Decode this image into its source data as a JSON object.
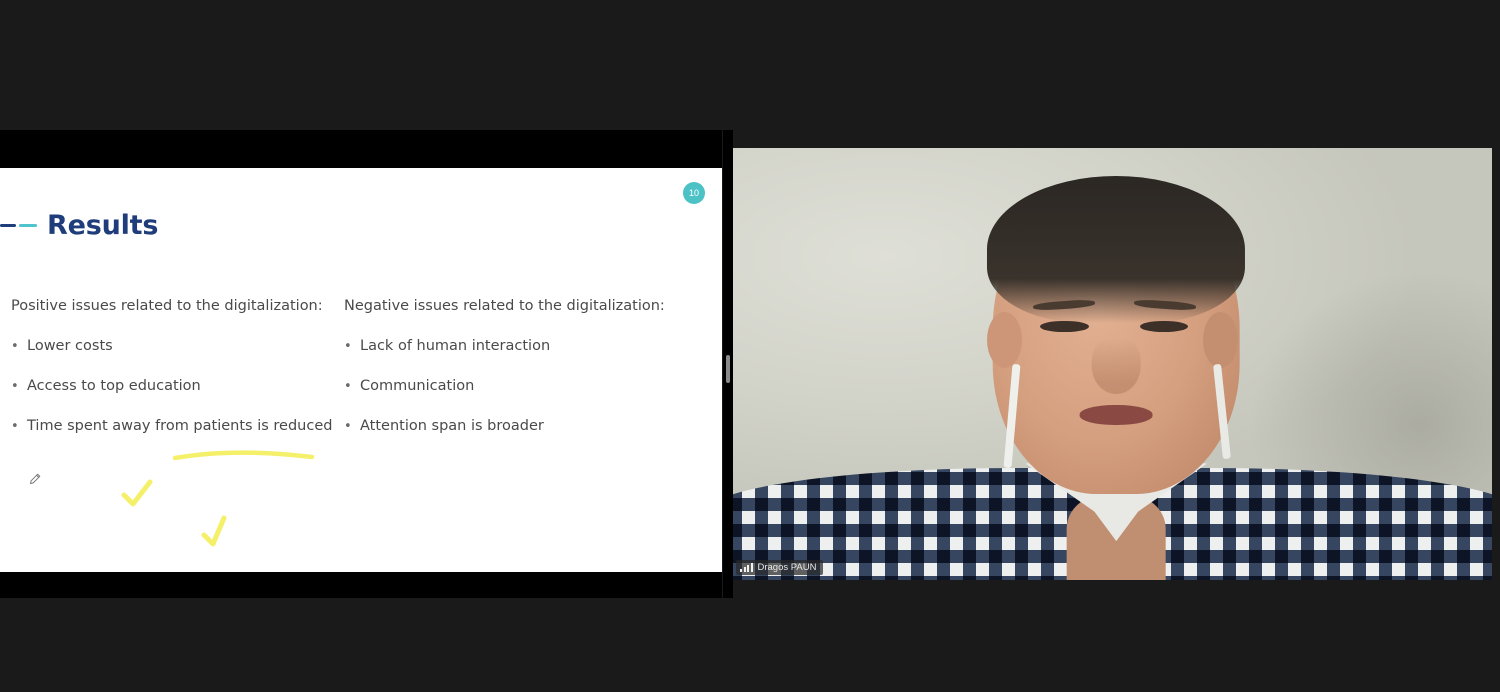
{
  "meeting": {
    "background_color": "#1a1a1a"
  },
  "shared_screen": {
    "panel_name": "shared-screen-panel",
    "slide": {
      "number_badge": "10",
      "title": "Results",
      "title_color": "#1f3d7a",
      "accent_colors": [
        "#1f3d7a",
        "#4fc3ce"
      ],
      "badge_color": "#4cc2c6",
      "columns": [
        {
          "heading": "Positive issues related to the digitalization:",
          "bullets": [
            "Lower costs",
            "Access to top education",
            "Time spent away from patients is reduced"
          ]
        },
        {
          "heading": "Negative issues related to the digitalization:",
          "bullets": [
            "Lack of human interaction",
            "Communication",
            "Attention span is broader"
          ]
        }
      ],
      "annotations": {
        "highlight_color": "#f5f06a",
        "marks": [
          {
            "type": "underline",
            "target": "Positive issues related to the digitalization:"
          },
          {
            "type": "checkmark",
            "target": "Lower costs"
          },
          {
            "type": "checkmark",
            "target": "Access to top education"
          }
        ],
        "cursor_icon": "pencil-icon"
      }
    }
  },
  "splitter": {
    "name": "panel-resize-handle"
  },
  "video_tile": {
    "participant_name": "Dragos PAUN",
    "signal_icon": "signal-bars-icon",
    "camera_on": true
  }
}
